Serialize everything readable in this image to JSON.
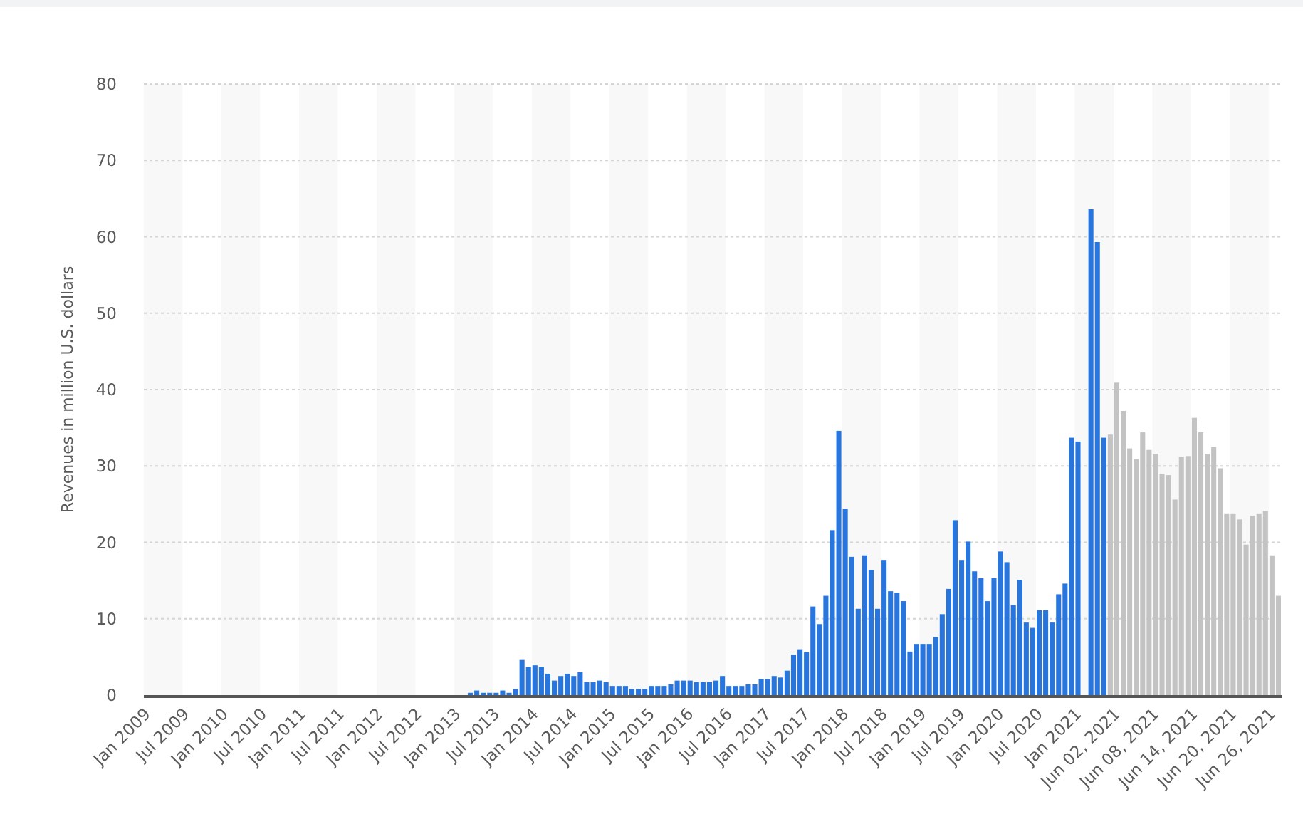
{
  "chart_data": {
    "type": "bar",
    "ylabel": "Revenues in million U.S. dollars",
    "ylim": [
      0,
      80
    ],
    "yticks": [
      0,
      10,
      20,
      30,
      40,
      50,
      60,
      70,
      80
    ],
    "grid": true,
    "categories": [
      "Jan 2009",
      null,
      null,
      null,
      null,
      null,
      "Jul 2009",
      null,
      null,
      null,
      null,
      null,
      "Jan 2010",
      null,
      null,
      null,
      null,
      null,
      "Jul 2010",
      null,
      null,
      null,
      null,
      null,
      "Jan 2011",
      null,
      null,
      null,
      null,
      null,
      "Jul 2011",
      null,
      null,
      null,
      null,
      null,
      "Jan 2012",
      null,
      null,
      null,
      null,
      null,
      "Jul 2012",
      null,
      null,
      null,
      null,
      null,
      "Jan 2013",
      null,
      null,
      null,
      null,
      null,
      "Jul 2013",
      null,
      null,
      null,
      null,
      null,
      "Jan 2014",
      null,
      null,
      null,
      null,
      null,
      "Jul 2014",
      null,
      null,
      null,
      null,
      null,
      "Jan 2015",
      null,
      null,
      null,
      null,
      null,
      "Jul 2015",
      null,
      null,
      null,
      null,
      null,
      "Jan 2016",
      null,
      null,
      null,
      null,
      null,
      "Jul 2016",
      null,
      null,
      null,
      null,
      null,
      "Jan 2017",
      null,
      null,
      null,
      null,
      null,
      "Jul 2017",
      null,
      null,
      null,
      null,
      null,
      "Jan 2018",
      null,
      null,
      null,
      null,
      null,
      "Jul 2018",
      null,
      null,
      null,
      null,
      null,
      "Jan 2019",
      null,
      null,
      null,
      null,
      null,
      "Jul 2019",
      null,
      null,
      null,
      null,
      null,
      "Jan 2020",
      null,
      null,
      null,
      null,
      null,
      "Jul 2020",
      null,
      null,
      null,
      null,
      null,
      "Jan 2021",
      null,
      null,
      null,
      null,
      null,
      "Jun 02, 2021",
      null,
      null,
      null,
      null,
      null,
      "Jun 08, 2021",
      null,
      null,
      null,
      null,
      null,
      "Jun 14, 2021",
      null,
      null,
      null,
      null,
      null,
      "Jun 20, 2021",
      null,
      null,
      null,
      null,
      null,
      "Jun 26, 2021",
      null
    ],
    "series": [
      {
        "color": "#2876dd",
        "values": [
          null,
          null,
          null,
          null,
          null,
          null,
          null,
          null,
          null,
          null,
          null,
          null,
          null,
          null,
          null,
          null,
          null,
          null,
          null,
          null,
          null,
          null,
          null,
          null,
          null,
          null,
          null,
          null,
          null,
          null,
          null,
          null,
          null,
          null,
          null,
          null,
          null,
          null,
          null,
          null,
          null,
          null,
          null,
          null,
          null,
          null,
          null,
          null,
          null,
          null,
          0.3,
          0.6,
          0.3,
          0.3,
          0.3,
          0.6,
          0.3,
          0.8,
          4.6,
          3.7,
          3.9,
          3.7,
          2.8,
          1.9,
          2.5,
          2.8,
          2.5,
          3.0,
          1.7,
          1.7,
          1.9,
          1.7,
          1.2,
          1.2,
          1.2,
          0.8,
          0.8,
          0.8,
          1.2,
          1.2,
          1.2,
          1.4,
          1.9,
          1.9,
          1.9,
          1.7,
          1.7,
          1.7,
          1.9,
          2.5,
          1.2,
          1.2,
          1.2,
          1.4,
          1.4,
          2.1,
          2.1,
          2.5,
          2.3,
          3.2,
          5.3,
          6.0,
          5.6,
          11.6,
          9.3,
          13.0,
          21.6,
          34.6,
          24.4,
          18.1,
          11.3,
          18.3,
          16.4,
          11.3,
          17.7,
          13.6,
          13.4,
          12.3,
          5.7,
          6.7,
          6.7,
          6.7,
          7.6,
          10.6,
          13.9,
          22.9,
          17.7,
          20.1,
          16.2,
          15.3,
          12.3,
          15.3,
          18.8,
          17.4,
          11.8,
          15.1,
          9.5,
          8.8,
          11.1,
          11.1,
          9.5,
          13.2,
          14.6,
          33.7,
          33.2,
          null,
          63.6,
          59.3,
          33.7,
          null,
          null,
          null,
          null,
          null,
          null,
          null,
          null,
          null,
          null,
          null,
          null,
          null,
          null,
          null,
          null,
          null,
          null,
          null,
          null,
          null,
          null,
          null,
          null,
          null,
          null,
          null
        ]
      },
      {
        "color": "#c3c3c3",
        "values": [
          null,
          null,
          null,
          null,
          null,
          null,
          null,
          null,
          null,
          null,
          null,
          null,
          null,
          null,
          null,
          null,
          null,
          null,
          null,
          null,
          null,
          null,
          null,
          null,
          null,
          null,
          null,
          null,
          null,
          null,
          null,
          null,
          null,
          null,
          null,
          null,
          null,
          null,
          null,
          null,
          null,
          null,
          null,
          null,
          null,
          null,
          null,
          null,
          null,
          null,
          null,
          null,
          null,
          null,
          null,
          null,
          null,
          null,
          null,
          null,
          null,
          null,
          null,
          null,
          null,
          null,
          null,
          null,
          null,
          null,
          null,
          null,
          null,
          null,
          null,
          null,
          null,
          null,
          null,
          null,
          null,
          null,
          null,
          null,
          null,
          null,
          null,
          null,
          null,
          null,
          null,
          null,
          null,
          null,
          null,
          null,
          null,
          null,
          null,
          null,
          null,
          null,
          null,
          null,
          null,
          null,
          null,
          null,
          null,
          null,
          null,
          null,
          null,
          null,
          null,
          null,
          null,
          null,
          null,
          null,
          null,
          null,
          null,
          null,
          null,
          null,
          null,
          null,
          null,
          null,
          null,
          null,
          null,
          null,
          null,
          null,
          null,
          null,
          null,
          null,
          null,
          null,
          null,
          null,
          null,
          null,
          null,
          null,
          null,
          34.1,
          40.9,
          37.2,
          32.3,
          30.9,
          34.4,
          32.1,
          31.6,
          29.0,
          28.8,
          25.6,
          31.2,
          31.3,
          36.3,
          34.4,
          31.6,
          32.5,
          29.7,
          23.7,
          23.7,
          23.0,
          19.7,
          23.5,
          23.7,
          24.1,
          18.3,
          13.0
        ]
      }
    ]
  }
}
